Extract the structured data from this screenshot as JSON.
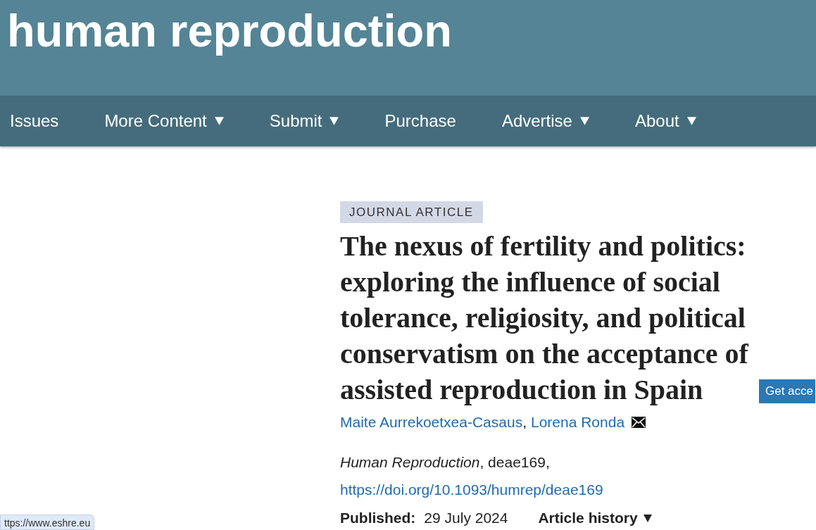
{
  "header": {
    "journal_title": "human reproduction"
  },
  "nav": [
    {
      "label": "Issues",
      "has_menu": false
    },
    {
      "label": "More Content",
      "has_menu": true
    },
    {
      "label": "Submit",
      "has_menu": true
    },
    {
      "label": "Purchase",
      "has_menu": false
    },
    {
      "label": "Advertise",
      "has_menu": true
    },
    {
      "label": "About",
      "has_menu": true
    }
  ],
  "article": {
    "type_badge": "JOURNAL ARTICLE",
    "title": "The nexus of fertility and politics: exploring the influence of social tolerance, religiosity, and political conservatism on the acceptance of assisted reproduction in Spain",
    "access_button": "Get acce",
    "authors": [
      {
        "name": "Maite Aurrekoetxea-Casaus",
        "corresponding": false
      },
      {
        "name": "Lorena Ronda",
        "corresponding": true
      }
    ],
    "author_separator": ",",
    "citation": "*Human Reproduction*, deae169,",
    "doi": "https://doi.org/10.1093/humrep/deae169",
    "published_label": "Published:",
    "published_date": "29 July 2024",
    "history": {
      "label": "Article history",
      "has_menu": true
    }
  },
  "status_bar": {
    "url": "ttps://www.eshre.eu"
  }
}
